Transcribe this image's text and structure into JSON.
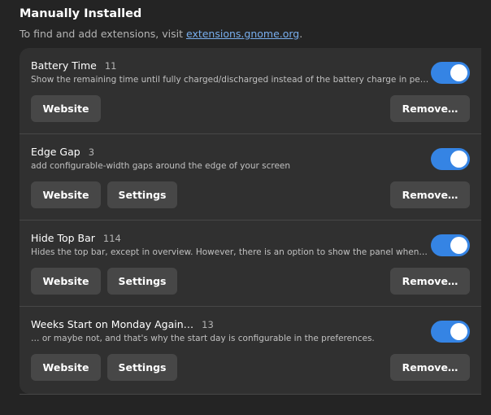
{
  "section": {
    "title": "Manually Installed",
    "subtitle_prefix": "To find and add extensions, visit ",
    "subtitle_link": "extensions.gnome.org",
    "subtitle_suffix": "."
  },
  "colors": {
    "accent": "#3584e4",
    "link": "#78aeed",
    "background": "#242424",
    "card": "#303030",
    "button": "#474747"
  },
  "buttons": {
    "website": "Website",
    "settings": "Settings",
    "remove": "Remove…"
  },
  "extensions": [
    {
      "name": "Battery Time",
      "count": "11",
      "description": "Show the remaining time until fully charged/discharged instead of the battery charge in percent…",
      "enabled": true,
      "has_settings": false
    },
    {
      "name": "Edge Gap",
      "count": "3",
      "description": "add configurable-width gaps around the edge of your screen",
      "enabled": true,
      "has_settings": true
    },
    {
      "name": "Hide Top Bar",
      "count": "114",
      "description": "Hides the top bar, except in overview. However, there is an option to show the panel whenever …",
      "enabled": true,
      "has_settings": true
    },
    {
      "name": "Weeks Start on Monday Again…",
      "count": "13",
      "description": "… or maybe not, and that's why the start day is configurable in the preferences.",
      "enabled": true,
      "has_settings": true
    }
  ]
}
